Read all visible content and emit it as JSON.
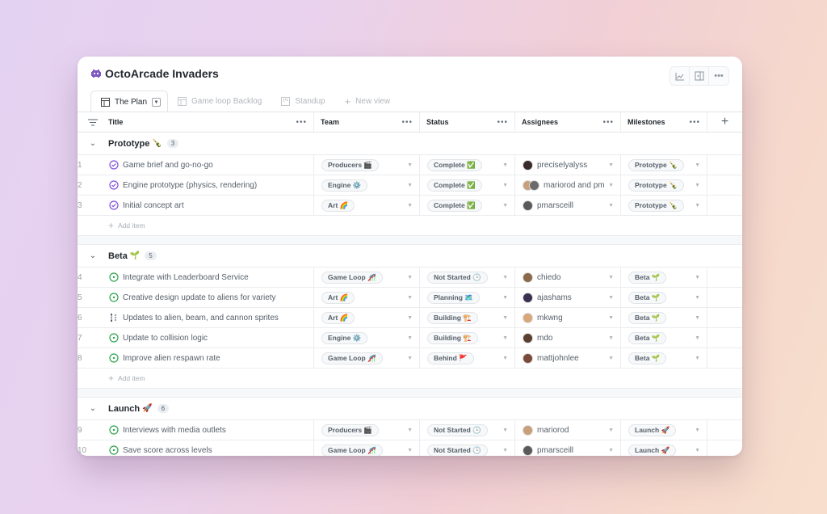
{
  "app": {
    "title": "OctoArcade Invaders",
    "logo_icon": "space-invader-icon",
    "top_actions": [
      {
        "name": "insights-button",
        "icon": "line-chart-icon"
      },
      {
        "name": "side-panel-button",
        "icon": "side-panel-icon"
      },
      {
        "name": "more-options-button",
        "icon": "kebab-icon"
      }
    ]
  },
  "tabs": [
    {
      "label": "The Plan",
      "icon": "table-icon",
      "active": true,
      "has_dropdown": true
    },
    {
      "label": "Game loop Backlog",
      "icon": "table-icon",
      "active": false
    },
    {
      "label": "Standup",
      "icon": "board-icon",
      "active": false
    },
    {
      "label": "New view",
      "icon": "plus-icon",
      "active": false
    }
  ],
  "columns": [
    {
      "key": "title",
      "label": "Title",
      "menu": "•••"
    },
    {
      "key": "team",
      "label": "Team",
      "menu": "•••"
    },
    {
      "key": "status",
      "label": "Status",
      "menu": "•••"
    },
    {
      "key": "assignees",
      "label": "Assignees",
      "menu": "•••"
    },
    {
      "key": "milestones",
      "label": "Milestones",
      "menu": "•••"
    }
  ],
  "add_column_label": "+",
  "add_item_label": "Add item",
  "colors": {
    "done_icon": "#8250df",
    "open_icon": "#2da44e"
  },
  "groups": [
    {
      "name": "Prototype",
      "emoji": "🍾",
      "count": "3",
      "items": [
        {
          "num": "1",
          "state": "done",
          "title": "Game brief and go-no-go",
          "team": "Producers 🎬",
          "status": "Complete ✅",
          "assignees": "preciselyalyss",
          "avatar_colors": [
            "#3b2a2a"
          ],
          "milestone": "Prototype 🍾"
        },
        {
          "num": "2",
          "state": "done",
          "title": "Engine prototype (physics, rendering)",
          "team": "Engine ⚙️",
          "status": "Complete ✅",
          "assignees": "mariorod and pm",
          "avatar_colors": [
            "#c9a07a",
            "#6b6b6b"
          ],
          "milestone": "Prototype 🍾"
        },
        {
          "num": "3",
          "state": "done",
          "title": "Initial concept art",
          "team": "Art 🌈",
          "status": "Complete ✅",
          "assignees": "pmarsceill",
          "avatar_colors": [
            "#5a5a5a"
          ],
          "milestone": "Prototype 🍾"
        }
      ]
    },
    {
      "name": "Beta",
      "emoji": "🌱",
      "count": "5",
      "items": [
        {
          "num": "4",
          "state": "open",
          "title": "Integrate with Leaderboard Service",
          "team": "Game Loop 🎢",
          "status": "Not Started 🕒",
          "assignees": "chiedo",
          "avatar_colors": [
            "#8a6a4a"
          ],
          "milestone": "Beta 🌱"
        },
        {
          "num": "5",
          "state": "open",
          "title": "Creative design update to aliens for variety",
          "team": "Art 🌈",
          "status": "Planning 🗺️",
          "assignees": "ajashams",
          "avatar_colors": [
            "#3a3050"
          ],
          "milestone": "Beta 🌱"
        },
        {
          "num": "6",
          "state": "draft",
          "title": "Updates to alien, beam, and cannon sprites",
          "team": "Art 🌈",
          "status": "Building 🏗️",
          "assignees": "mkwng",
          "avatar_colors": [
            "#d8a77a"
          ],
          "milestone": "Beta 🌱"
        },
        {
          "num": "7",
          "state": "open",
          "title": "Update to collision logic",
          "team": "Engine ⚙️",
          "status": "Building 🏗️",
          "assignees": "mdo",
          "avatar_colors": [
            "#5a4030"
          ],
          "milestone": "Beta 🌱"
        },
        {
          "num": "8",
          "state": "open",
          "title": "Improve alien respawn rate",
          "team": "Game Loop 🎢",
          "status": "Behind 🚩",
          "assignees": "mattjohnlee",
          "avatar_colors": [
            "#7a4a3a"
          ],
          "milestone": "Beta 🌱"
        }
      ]
    },
    {
      "name": "Launch",
      "emoji": "🚀",
      "count": "6",
      "items": [
        {
          "num": "9",
          "state": "open",
          "title": "Interviews with media outlets",
          "team": "Producers 🎬",
          "status": "Not Started 🕒",
          "assignees": "mariorod",
          "avatar_colors": [
            "#c9a07a"
          ],
          "milestone": "Launch 🚀"
        },
        {
          "num": "10",
          "state": "open",
          "title": "Save score across levels",
          "team": "Game Loop 🎢",
          "status": "Not Started 🕒",
          "assignees": "pmarsceill",
          "avatar_colors": [
            "#5a5a5a"
          ],
          "milestone": "Launch 🚀"
        }
      ]
    }
  ]
}
